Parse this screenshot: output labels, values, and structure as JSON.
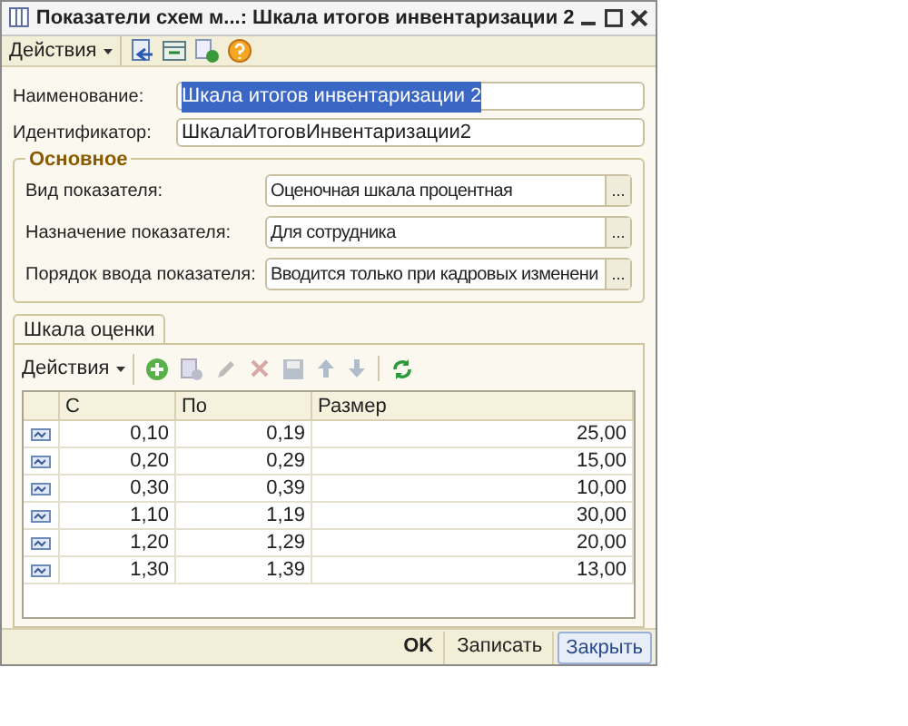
{
  "window": {
    "title": "Показатели схем м...: Шкала итогов инвентаризации 2"
  },
  "toolbar": {
    "actions_label": "Действия"
  },
  "fields": [
    {
      "label": "Наименование:",
      "value": "Шкала итогов инвентаризации 2",
      "selected": true
    },
    {
      "label": "Идентификатор:",
      "value": "ШкалаИтоговИнвентаризации2",
      "selected": false
    }
  ],
  "group": {
    "title": "Основное",
    "fields": [
      {
        "label": "Вид показателя:",
        "value": "Оценочная шкала процентная",
        "button": "..."
      },
      {
        "label": "Назначение показателя:",
        "value": "Для сотрудника",
        "button": "..."
      },
      {
        "label": "Порядок ввода показателя:",
        "value": "Вводится только при кадровых изменени",
        "button": "..."
      }
    ]
  },
  "tabs": [
    {
      "label": "Шкала оценки",
      "selected": true
    }
  ],
  "table_toolbar": {
    "actions_label": "Действия"
  },
  "table": {
    "columns": [
      "С",
      "По",
      "Размер"
    ],
    "rows": [
      {
        "from": "0,10",
        "to": "0,19",
        "size": "25,00"
      },
      {
        "from": "0,20",
        "to": "0,29",
        "size": "15,00"
      },
      {
        "from": "0,30",
        "to": "0,39",
        "size": "10,00"
      },
      {
        "from": "1,10",
        "to": "1,19",
        "size": "30,00"
      },
      {
        "from": "1,20",
        "to": "1,29",
        "size": "20,00"
      },
      {
        "from": "1,30",
        "to": "1,39",
        "size": "13,00"
      }
    ]
  },
  "buttons": [
    {
      "label": "OK",
      "kind": "default"
    },
    {
      "label": "Записать",
      "kind": "normal"
    },
    {
      "label": "Закрыть",
      "kind": "focused"
    }
  ]
}
